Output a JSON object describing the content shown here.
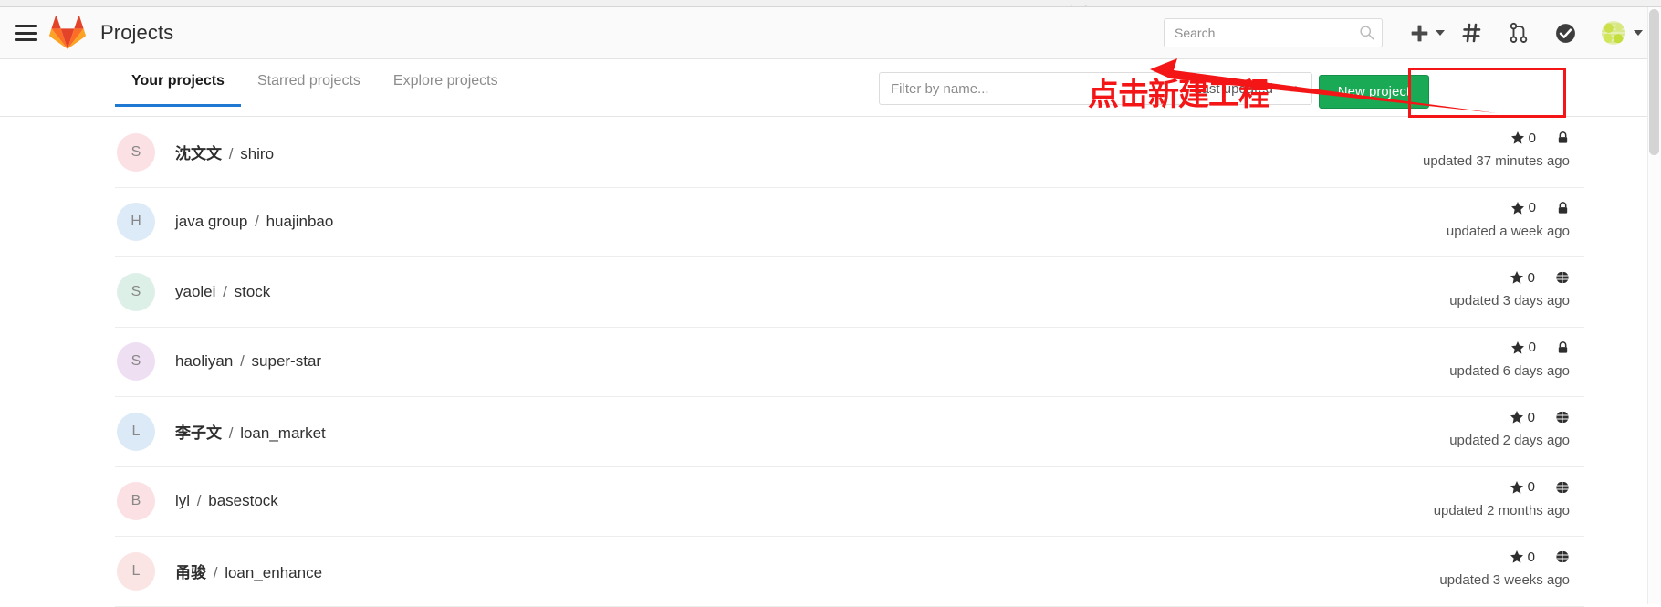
{
  "navbar": {
    "menu_icon": "hamburger-icon",
    "logo_icon": "gitlab-logo-icon",
    "title": "Projects",
    "search": {
      "placeholder": "Search",
      "value": "",
      "icon": "search-icon"
    },
    "icons": [
      {
        "name": "plus-icon",
        "label": "+"
      },
      {
        "name": "issues-hash-icon",
        "label": "#"
      },
      {
        "name": "merge-request-icon",
        "label": "merge requests"
      },
      {
        "name": "todos-check-icon",
        "label": "todos"
      }
    ],
    "avatar_icon": "user-avatar-identicon"
  },
  "subheader": {
    "tabs": [
      {
        "label": "Your projects",
        "active": true
      },
      {
        "label": "Starred projects",
        "active": false
      },
      {
        "label": "Explore projects",
        "active": false
      }
    ],
    "filter": {
      "placeholder": "Filter by name...",
      "value": ""
    },
    "sort": {
      "selected": "Last updated",
      "chevron_icon": "chevron-down-icon"
    },
    "new_project_label": "New project"
  },
  "annotation": {
    "text": "点击新建工程",
    "color": "#f41616",
    "arrow_icon": "arrow-left-icon",
    "highlight_color": "#f41616"
  },
  "theme": {
    "accent_green": "#1aaa55",
    "tab_active_underline": "#1f78d1",
    "brand_orange": "#e24329"
  },
  "projects": [
    {
      "avatar_letter": "S",
      "avatar_color": "#fbe0e4",
      "namespace": "沈文文",
      "name": "shiro",
      "stars": "0",
      "visibility": "private",
      "updated": "updated 37 minutes ago"
    },
    {
      "avatar_letter": "H",
      "avatar_color": "#ddeaf8",
      "namespace": "java group",
      "name": "huajinbao",
      "namespace_bold": false,
      "stars": "0",
      "visibility": "private",
      "updated": "updated a week ago"
    },
    {
      "avatar_letter": "S",
      "avatar_color": "#ddf0e7",
      "namespace": "yaolei",
      "name": "stock",
      "namespace_bold": false,
      "stars": "0",
      "visibility": "public",
      "updated": "updated 3 days ago"
    },
    {
      "avatar_letter": "S",
      "avatar_color": "#eee0f2",
      "namespace": "haoliyan",
      "name": "super-star",
      "namespace_bold": false,
      "stars": "0",
      "visibility": "private",
      "updated": "updated 6 days ago"
    },
    {
      "avatar_letter": "L",
      "avatar_color": "#dceaf7",
      "namespace": "李子文",
      "name": "loan_market",
      "stars": "0",
      "visibility": "public",
      "updated": "updated 2 days ago"
    },
    {
      "avatar_letter": "B",
      "avatar_color": "#fbe0e4",
      "namespace": "lyl",
      "name": "basestock",
      "namespace_bold": false,
      "stars": "0",
      "visibility": "public",
      "updated": "updated 2 months ago"
    },
    {
      "avatar_letter": "L",
      "avatar_color": "#fbe4e4",
      "namespace": "甬骏",
      "name": "loan_enhance",
      "stars": "0",
      "visibility": "public",
      "updated": "updated 3 weeks ago"
    }
  ]
}
